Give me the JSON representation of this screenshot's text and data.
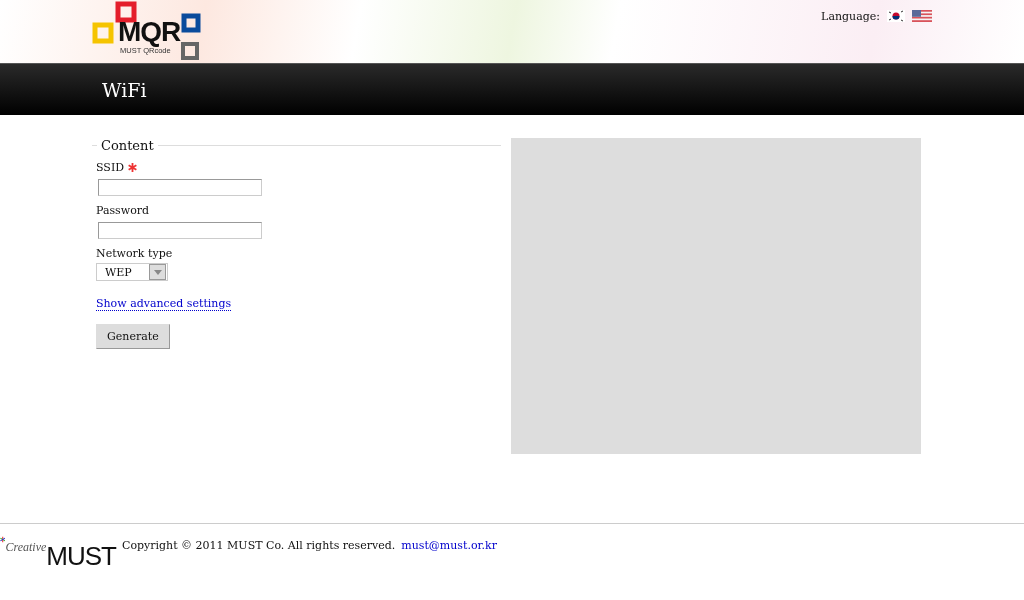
{
  "header": {
    "logo": {
      "title": "MQR",
      "subtitle": "MUST QRcode"
    },
    "language_label": "Language:"
  },
  "page_title": "WiFi",
  "form": {
    "legend": "Content",
    "fields": [
      {
        "kind": "text",
        "label": "SSID",
        "required": true
      },
      {
        "kind": "text",
        "label": "Password",
        "required": false
      },
      {
        "kind": "select",
        "label": "Network type",
        "required": false,
        "value": "WEP"
      }
    ],
    "advanced_link": "Show advanced settings",
    "submit": "Generate"
  },
  "footer": {
    "logo": {
      "prefix": "Creative",
      "name": "MUST"
    },
    "copyright": "Copyright © 2011 MUST Co. All rights reserved.",
    "email": "must@must.or.kr"
  }
}
